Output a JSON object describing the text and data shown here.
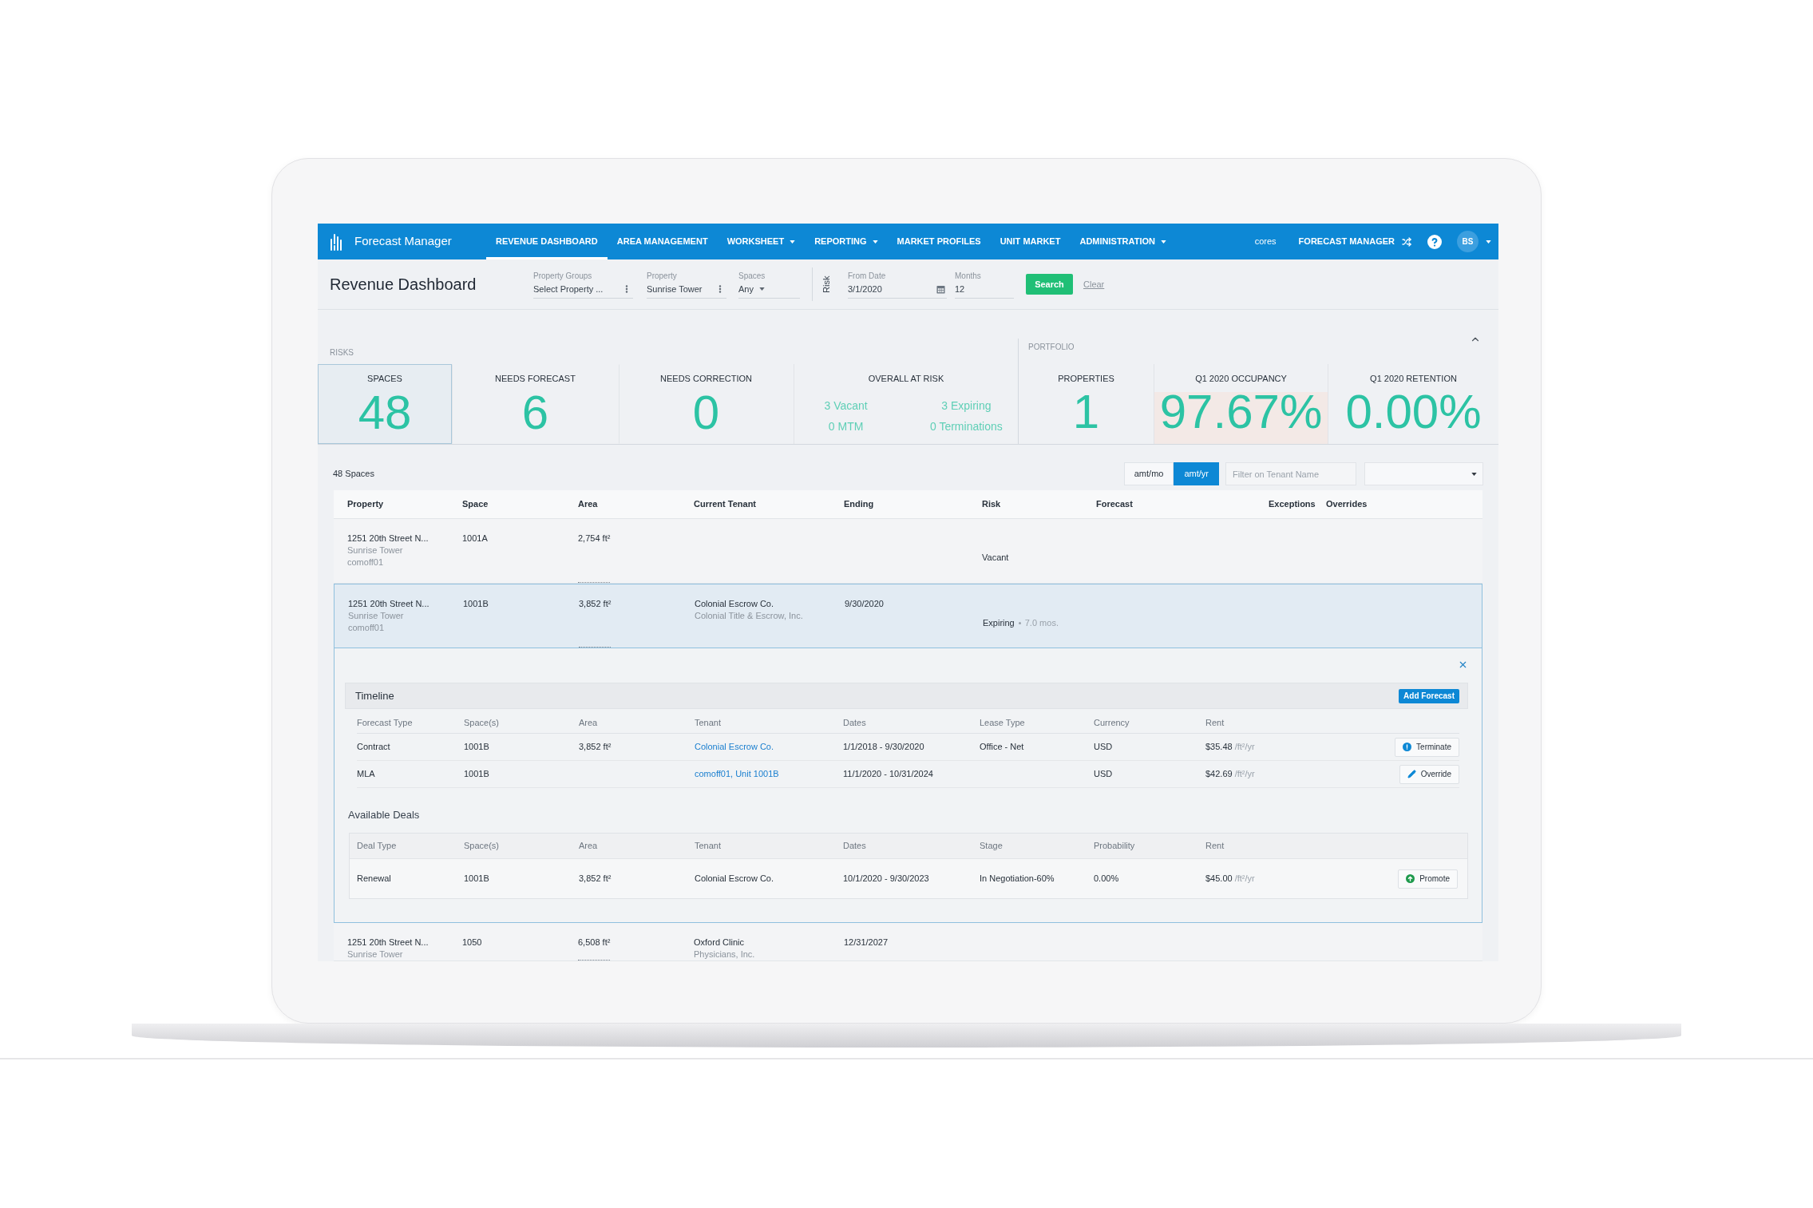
{
  "nav": {
    "brand": "Forecast Manager",
    "items": [
      {
        "label": "REVENUE DASHBOARD",
        "selected": true,
        "dropdown": false
      },
      {
        "label": "AREA MANAGEMENT",
        "selected": false,
        "dropdown": false
      },
      {
        "label": "WORKSHEET",
        "selected": false,
        "dropdown": true
      },
      {
        "label": "REPORTING",
        "selected": false,
        "dropdown": true
      },
      {
        "label": "MARKET PROFILES",
        "selected": false,
        "dropdown": false
      },
      {
        "label": "UNIT MARKET",
        "selected": false,
        "dropdown": false
      },
      {
        "label": "ADMINISTRATION",
        "selected": false,
        "dropdown": true
      }
    ],
    "org": "cores",
    "app_switch": "FORECAST MANAGER",
    "avatar": "BS"
  },
  "header": {
    "title": "Revenue Dashboard",
    "filters": [
      {
        "label": "Property Groups",
        "value": "Select Property ...",
        "kind": "menu"
      },
      {
        "label": "Property",
        "value": "Sunrise Tower",
        "kind": "menu"
      },
      {
        "label": "Spaces",
        "value": "Any",
        "kind": "select"
      }
    ],
    "risk_label": "Risk",
    "date_filters": [
      {
        "label": "From Date",
        "value": "3/1/2020",
        "kind": "date"
      },
      {
        "label": "Months",
        "value": "12",
        "kind": "text"
      }
    ],
    "search_button": "Search",
    "clear_link": "Clear"
  },
  "risks": {
    "title": "RISKS",
    "stats": [
      {
        "label": "SPACES",
        "value": "48",
        "selected": true
      },
      {
        "label": "NEEDS FORECAST",
        "value": "6",
        "selected": false
      },
      {
        "label": "NEEDS CORRECTION",
        "value": "0",
        "selected": false
      }
    ],
    "overall": {
      "label": "OVERALL AT RISK",
      "items": [
        "3 Vacant",
        "3 Expiring",
        "0 MTM",
        "0 Terminations"
      ]
    }
  },
  "portfolio": {
    "title": "PORTFOLIO",
    "expanded": true,
    "stats": [
      {
        "label": "PROPERTIES",
        "value": "1",
        "highlighted": false
      },
      {
        "label": "Q1 2020 OCCUPANCY",
        "value": "97.67%",
        "highlighted": true
      },
      {
        "label": "Q1 2020 RETENTION",
        "value": "0.00%",
        "highlighted": false
      }
    ]
  },
  "spaces": {
    "count": "48 Spaces",
    "units": [
      {
        "label": "amt/mo",
        "selected": false
      },
      {
        "label": "amt/yr",
        "selected": true
      }
    ],
    "filter": {
      "placeholder": "Filter on Tenant Name"
    },
    "columns": [
      "Property",
      "Space",
      "Area",
      "Current Tenant",
      "Ending",
      "Risk",
      "Forecast",
      "Exceptions",
      "Overrides"
    ],
    "rows": [
      {
        "property": "1251 20th Street N...",
        "building": "Sunrise Tower",
        "code": "comoff01",
        "space": "1001A",
        "area": "2,754 ft²",
        "risk": "Vacant",
        "selected": false
      },
      {
        "property": "1251 20th Street N...",
        "building": "Sunrise Tower",
        "code": "comoff01",
        "space": "1001B",
        "area": "3,852 ft²",
        "tenant": "Colonial Escrow Co.",
        "tenant_detail": "Colonial Title & Escrow, Inc.",
        "ending": "9/30/2020",
        "risk": "Expiring",
        "risk_detail": "7.0 mos.",
        "selected": true,
        "detail": {
          "timeline": {
            "title": "Timeline",
            "add_button": "Add Forecast",
            "columns": [
              "Forecast Type",
              "Space(s)",
              "Area",
              "Tenant",
              "Dates",
              "Lease Type",
              "Currency",
              "Rent"
            ],
            "rows": [
              {
                "type": "Contract",
                "spaces": "1001B",
                "area": "3,852 ft²",
                "tenant": "Colonial Escrow Co.",
                "dates": "1/1/2018 - 9/30/2020",
                "lease_type": "Office - Net",
                "currency": "USD",
                "rent": "$35.48",
                "rent_unit": "/ft²/yr",
                "action": {
                  "kind": "terminate",
                  "label": "Terminate"
                }
              },
              {
                "type": "MLA",
                "spaces": "1001B",
                "tenant": "comoff01, Unit 1001B",
                "dates": "11/1/2020 - 10/31/2024",
                "currency": "USD",
                "rent": "$42.69",
                "rent_unit": "/ft²/yr",
                "action": {
                  "kind": "override",
                  "label": "Override"
                }
              }
            ]
          },
          "deals": {
            "title": "Available Deals",
            "columns": [
              "Deal Type",
              "Space(s)",
              "Area",
              "Tenant",
              "Dates",
              "Stage",
              "Probability",
              "Rent"
            ],
            "rows": [
              {
                "type": "Renewal",
                "spaces": "1001B",
                "area": "3,852 ft²",
                "tenant": "Colonial Escrow Co.",
                "dates": "10/1/2020 - 9/30/2023",
                "stage": "In Negotiation-60%",
                "probability": "0.00%",
                "rent": "$45.00",
                "rent_unit": "/ft²/yr",
                "action": {
                  "kind": "promote",
                  "label": "Promote"
                }
              }
            ]
          }
        }
      },
      {
        "property": "1251 20th Street N...",
        "building": "Sunrise Tower",
        "space": "1050",
        "area": "6,508 ft²",
        "tenant": "Oxford Clinic",
        "tenant_detail": "Physicians, Inc.",
        "ending": "12/31/2027",
        "selected": false
      }
    ]
  }
}
